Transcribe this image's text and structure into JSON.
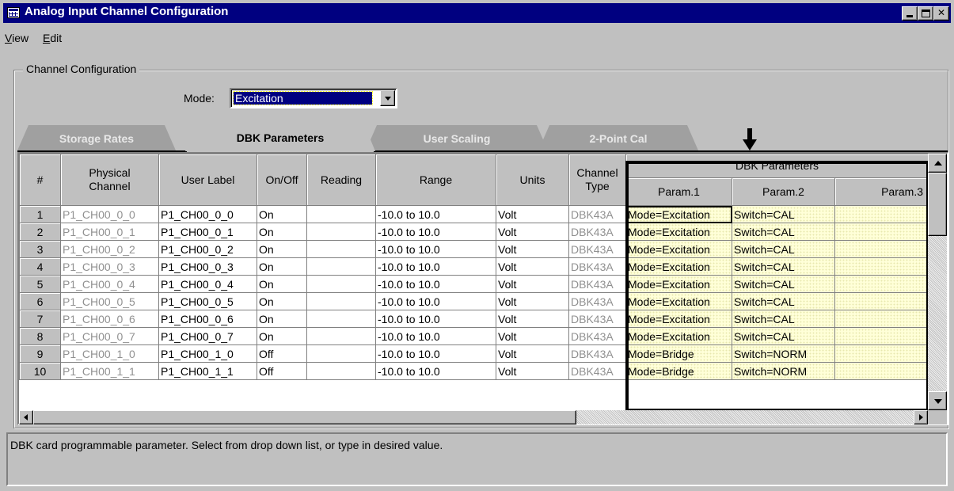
{
  "window": {
    "title": "Analog Input Channel Configuration",
    "controls": {
      "minimize": "_",
      "maximize": "□",
      "close": "✕"
    }
  },
  "menu": {
    "view": {
      "underlined": "V",
      "rest": "iew"
    },
    "edit": {
      "underlined": "E",
      "rest": "dit"
    }
  },
  "group": {
    "title": "Channel Configuration"
  },
  "mode": {
    "label": "Mode:",
    "value": "Excitation"
  },
  "tabs": [
    {
      "label": "Storage Rates",
      "active": false
    },
    {
      "label": "DBK Parameters",
      "active": true
    },
    {
      "label": "User Scaling",
      "active": false
    },
    {
      "label": "2-Point Cal",
      "active": false
    }
  ],
  "grid": {
    "headers": {
      "num": "#",
      "physical": "Physical Channel",
      "user_label": "User Label",
      "onoff": "On/Off",
      "reading": "Reading",
      "range": "Range",
      "units": "Units",
      "channel_type": "Channel Type",
      "dbk_group": "DBK Parameters",
      "param1": "Param.1",
      "param2": "Param.2",
      "param3": "Param.3"
    },
    "rows": [
      {
        "num": "1",
        "physical": "P1_CH00_0_0",
        "label": "P1_CH00_0_0",
        "onoff": "On",
        "reading": "",
        "range": "-10.0 to 10.0",
        "units": "Volt",
        "type": "DBK43A",
        "p1": "Mode=Excitation",
        "p2": "Switch=CAL",
        "p3": ""
      },
      {
        "num": "2",
        "physical": "P1_CH00_0_1",
        "label": "P1_CH00_0_1",
        "onoff": "On",
        "reading": "",
        "range": "-10.0 to 10.0",
        "units": "Volt",
        "type": "DBK43A",
        "p1": "Mode=Excitation",
        "p2": "Switch=CAL",
        "p3": ""
      },
      {
        "num": "3",
        "physical": "P1_CH00_0_2",
        "label": "P1_CH00_0_2",
        "onoff": "On",
        "reading": "",
        "range": "-10.0 to 10.0",
        "units": "Volt",
        "type": "DBK43A",
        "p1": "Mode=Excitation",
        "p2": "Switch=CAL",
        "p3": ""
      },
      {
        "num": "4",
        "physical": "P1_CH00_0_3",
        "label": "P1_CH00_0_3",
        "onoff": "On",
        "reading": "",
        "range": "-10.0 to 10.0",
        "units": "Volt",
        "type": "DBK43A",
        "p1": "Mode=Excitation",
        "p2": "Switch=CAL",
        "p3": ""
      },
      {
        "num": "5",
        "physical": "P1_CH00_0_4",
        "label": "P1_CH00_0_4",
        "onoff": "On",
        "reading": "",
        "range": "-10.0 to 10.0",
        "units": "Volt",
        "type": "DBK43A",
        "p1": "Mode=Excitation",
        "p2": "Switch=CAL",
        "p3": ""
      },
      {
        "num": "6",
        "physical": "P1_CH00_0_5",
        "label": "P1_CH00_0_5",
        "onoff": "On",
        "reading": "",
        "range": "-10.0 to 10.0",
        "units": "Volt",
        "type": "DBK43A",
        "p1": "Mode=Excitation",
        "p2": "Switch=CAL",
        "p3": ""
      },
      {
        "num": "7",
        "physical": "P1_CH00_0_6",
        "label": "P1_CH00_0_6",
        "onoff": "On",
        "reading": "",
        "range": "-10.0 to 10.0",
        "units": "Volt",
        "type": "DBK43A",
        "p1": "Mode=Excitation",
        "p2": "Switch=CAL",
        "p3": ""
      },
      {
        "num": "8",
        "physical": "P1_CH00_0_7",
        "label": "P1_CH00_0_7",
        "onoff": "On",
        "reading": "",
        "range": "-10.0 to 10.0",
        "units": "Volt",
        "type": "DBK43A",
        "p1": "Mode=Excitation",
        "p2": "Switch=CAL",
        "p3": ""
      },
      {
        "num": "9",
        "physical": "P1_CH00_1_0",
        "label": "P1_CH00_1_0",
        "onoff": "Off",
        "reading": "",
        "range": "-10.0 to 10.0",
        "units": "Volt",
        "type": "DBK43A",
        "p1": "Mode=Bridge",
        "p2": "Switch=NORM",
        "p3": ""
      },
      {
        "num": "10",
        "physical": "P1_CH00_1_1",
        "label": "P1_CH00_1_1",
        "onoff": "Off",
        "reading": "",
        "range": "-10.0 to 10.0",
        "units": "Volt",
        "type": "DBK43A",
        "p1": "Mode=Bridge",
        "p2": "Switch=NORM",
        "p3": ""
      }
    ]
  },
  "status": {
    "text": "DBK card programmable parameter. Select from drop down list, or type in desired value."
  },
  "icons": {
    "app": "grid-window-icon",
    "pointer": "down-arrow-icon",
    "dropdown": "chevron-down-icon"
  },
  "colors": {
    "titlebar": "#000080",
    "face": "#c0c0c0",
    "param_cell": "#ffffd8",
    "disabled_text": "#909090"
  }
}
